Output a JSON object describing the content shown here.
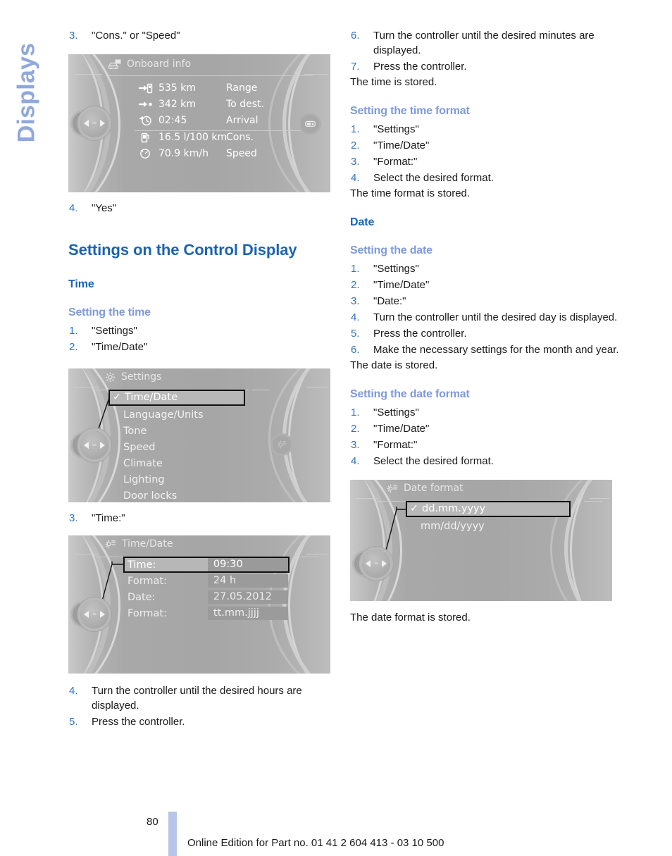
{
  "side_tab": {
    "label": "Displays"
  },
  "colors": {
    "heading_blue": "#1b63b4",
    "subheading_blue": "#7e9ada",
    "step_number_blue": "#2f74c0",
    "side_tab_blue": "#90a8da",
    "page_bar_blue": "#b7c5e8",
    "body_text": "#1a1a1a"
  },
  "left_column": {
    "step_cons_speed": {
      "num": "3.",
      "text": "\"Cons.\" or \"Speed\""
    },
    "onboard_screen": {
      "title": "Onboard info",
      "title_icon": "car-info-icon",
      "right_button_icon": "display-toggle-icon",
      "rows": [
        {
          "icon": "range-fuel-pump-icon",
          "value": "535 km",
          "label": "Range"
        },
        {
          "icon": "arrow-to-destination-icon",
          "value": "342 km",
          "label": "To dest."
        },
        {
          "icon": "clock-arrival-icon",
          "value": "02:45",
          "label": "Arrival"
        },
        {
          "icon": "consumption-fuel-pump-icon",
          "value": "16.5 l/100 km",
          "label": "Cons."
        },
        {
          "icon": "speedometer-icon",
          "value": "70.9 km/h",
          "label": "Speed"
        }
      ]
    },
    "step_yes": {
      "num": "4.",
      "text": "\"Yes\""
    },
    "section_title": "Settings on the Control Display",
    "subsection_time": "Time",
    "proc_setting_the_time": {
      "title": "Setting the time",
      "steps": [
        {
          "num": "1.",
          "text": "\"Settings\""
        },
        {
          "num": "2.",
          "text": "\"Time/Date\""
        }
      ]
    },
    "settings_screen": {
      "title": "Settings",
      "title_icon": "gear-icon",
      "right_button_icon": "settings-gear-list-icon",
      "items": [
        {
          "label": "Time/Date",
          "selected": true,
          "check": "✓"
        },
        {
          "label": "Language/Units",
          "selected": false
        },
        {
          "label": "Tone",
          "selected": false
        },
        {
          "label": "Speed",
          "selected": false
        },
        {
          "label": "Climate",
          "selected": false
        },
        {
          "label": "Lighting",
          "selected": false
        },
        {
          "label": "Door locks",
          "selected": false
        }
      ]
    },
    "step_time_colon": {
      "num": "3.",
      "text": "\"Time:\""
    },
    "timedate_screen": {
      "title": "Time/Date",
      "title_icon": "gear-list-icon",
      "rows": [
        {
          "key": "Time:",
          "value": "09:30",
          "selected": true
        },
        {
          "key": "Format:",
          "value": "24 h",
          "selected": false
        },
        {
          "key": "Date:",
          "value": "27.05.2012",
          "selected": false
        },
        {
          "key": "Format:",
          "value": "tt.mm.jjjj",
          "selected": false
        }
      ]
    },
    "steps_after_timedate": [
      {
        "num": "4.",
        "text": "Turn the controller until the desired hours are displayed."
      },
      {
        "num": "5.",
        "text": "Press the controller."
      }
    ]
  },
  "right_column": {
    "steps_minutes": [
      {
        "num": "6.",
        "text": "Turn the controller until the desired minutes are displayed."
      },
      {
        "num": "7.",
        "text": "Press the controller."
      }
    ],
    "time_stored": "The time is stored.",
    "proc_setting_the_time_format": {
      "title": "Setting the time format",
      "steps": [
        {
          "num": "1.",
          "text": "\"Settings\""
        },
        {
          "num": "2.",
          "text": "\"Time/Date\""
        },
        {
          "num": "3.",
          "text": "\"Format:\""
        },
        {
          "num": "4.",
          "text": "Select the desired format."
        }
      ]
    },
    "time_format_stored": "The time format is stored.",
    "subsection_date": "Date",
    "proc_setting_the_date": {
      "title": "Setting the date",
      "steps": [
        {
          "num": "1.",
          "text": "\"Settings\""
        },
        {
          "num": "2.",
          "text": "\"Time/Date\""
        },
        {
          "num": "3.",
          "text": "\"Date:\""
        },
        {
          "num": "4.",
          "text": "Turn the controller until the desired day is displayed."
        },
        {
          "num": "5.",
          "text": "Press the controller."
        },
        {
          "num": "6.",
          "text": "Make the necessary settings for the month and year."
        }
      ]
    },
    "date_stored": "The date is stored.",
    "proc_setting_the_date_format": {
      "title": "Setting the date format",
      "steps": [
        {
          "num": "1.",
          "text": "\"Settings\""
        },
        {
          "num": "2.",
          "text": "\"Time/Date\""
        },
        {
          "num": "3.",
          "text": "\"Format:\""
        },
        {
          "num": "4.",
          "text": "Select the desired format."
        }
      ]
    },
    "dateformat_screen": {
      "title": "Date format",
      "title_icon": "gear-list-icon",
      "items": [
        {
          "label": "dd.mm.yyyy",
          "selected": true,
          "check": "✓"
        },
        {
          "label": "mm/dd/yyyy",
          "selected": false
        }
      ]
    },
    "date_format_stored": "The date format is stored."
  },
  "footer": {
    "page_number": "80",
    "text": "Online Edition for Part no. 01 41 2 604 413 - 03 10 500"
  }
}
